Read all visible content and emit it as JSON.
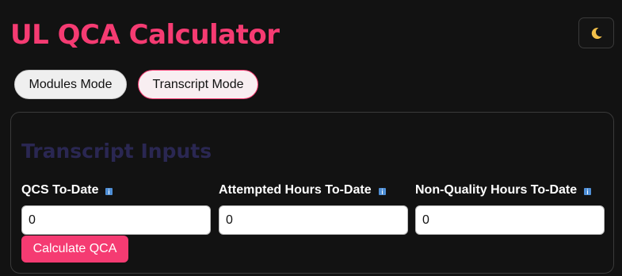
{
  "header": {
    "title": "UL QCA Calculator",
    "theme_toggle_icon": "moon-icon"
  },
  "modes": {
    "modules_label": "Modules Mode",
    "transcript_label": "Transcript Mode",
    "active": "Transcript Mode"
  },
  "transcript": {
    "section_title": "Transcript Inputs",
    "fields": [
      {
        "label": "QCS To-Date",
        "value": "0",
        "info_icon": "info-icon"
      },
      {
        "label": "Attempted Hours To-Date",
        "value": "0",
        "info_icon": "info-icon"
      },
      {
        "label": "Non-Quality Hours To-Date",
        "value": "0",
        "info_icon": "info-icon"
      }
    ],
    "calculate_label": "Calculate QCA"
  },
  "colors": {
    "accent": "#f53b72",
    "background": "#121212",
    "section_title": "#2a2752",
    "info_icon": "#4f8fd6",
    "moon": "#f2c04a"
  }
}
